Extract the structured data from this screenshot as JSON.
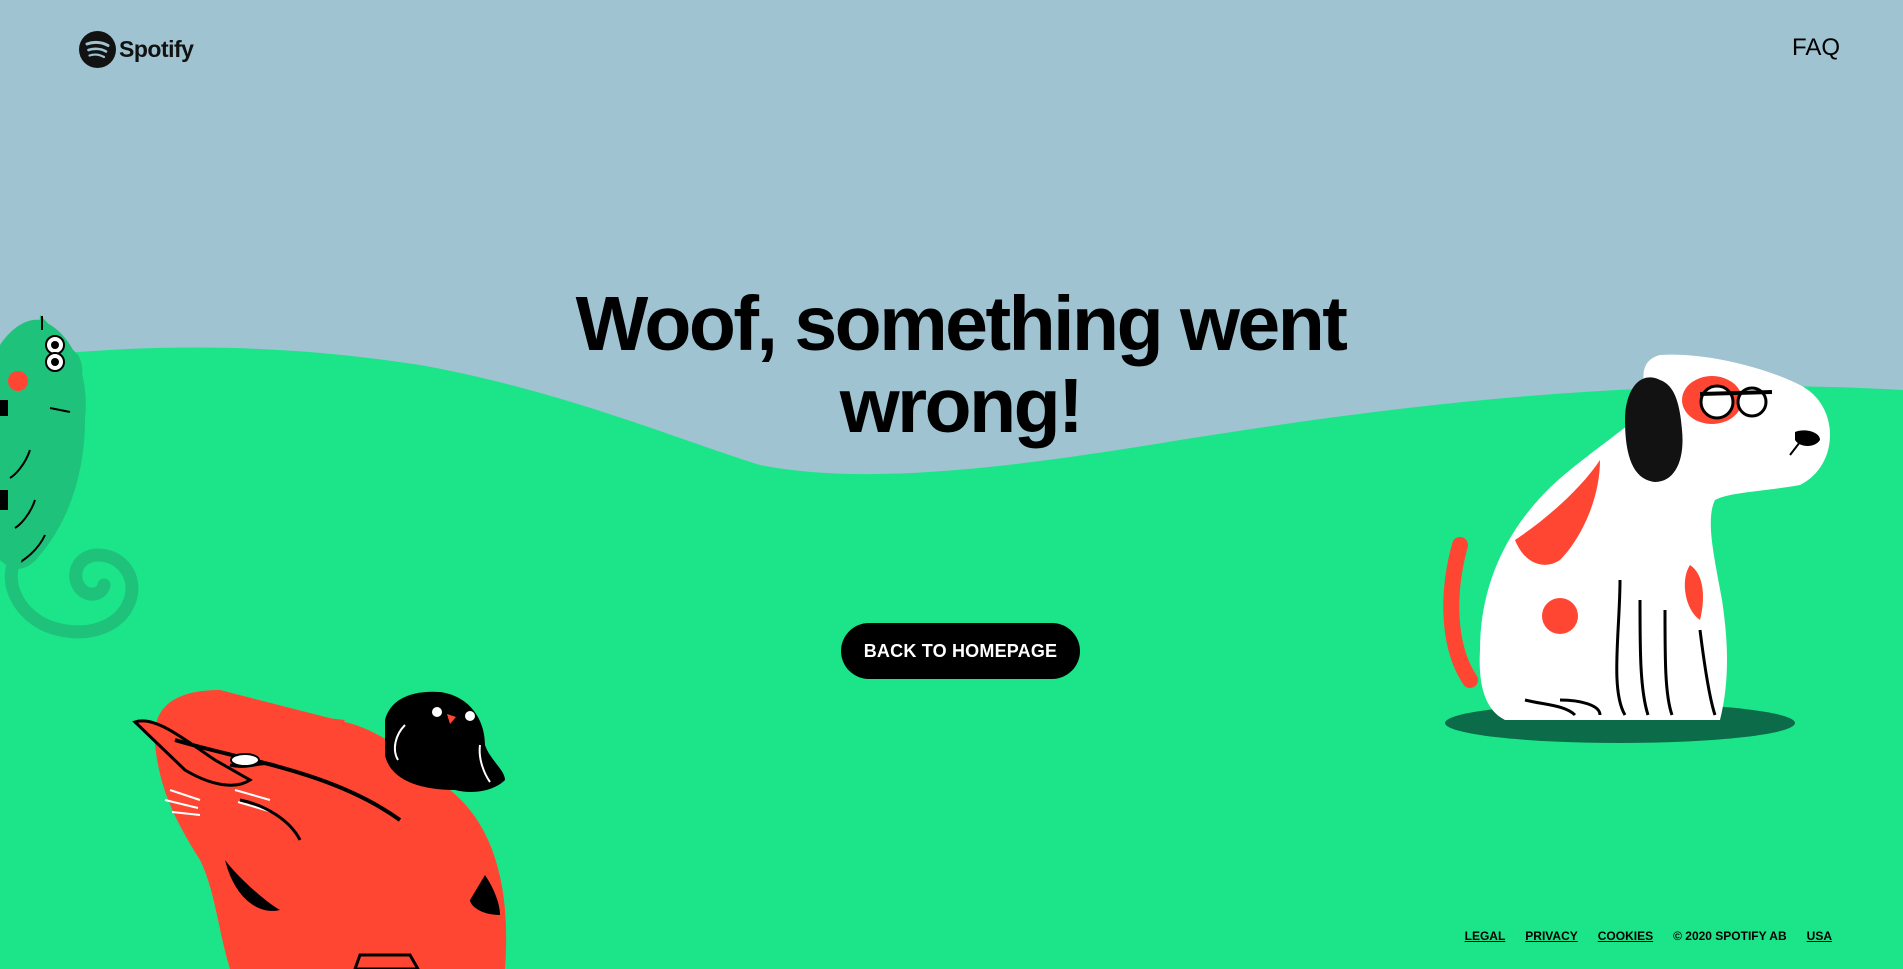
{
  "header": {
    "logo_text": "Spotify",
    "faq_label": "FAQ"
  },
  "main": {
    "headline_line1": "Woof, something went",
    "headline_line2": "wrong!",
    "cta_label": "BACK TO HOMEPAGE"
  },
  "footer": {
    "legal": "LEGAL",
    "privacy": "PRIVACY",
    "cookies": "COOKIES",
    "copyright": "© 2020 SPOTIFY AB",
    "country": "USA"
  },
  "colors": {
    "sky": "#9fc3d1",
    "grass": "#1ce589",
    "cat": "#ff4632",
    "dog_body": "#ffffff",
    "dog_spots": "#ff4632",
    "chameleon": "#1ec27a",
    "button": "#000000",
    "button_text": "#ffffff"
  },
  "icons": {
    "logo": "spotify-logo-icon"
  }
}
